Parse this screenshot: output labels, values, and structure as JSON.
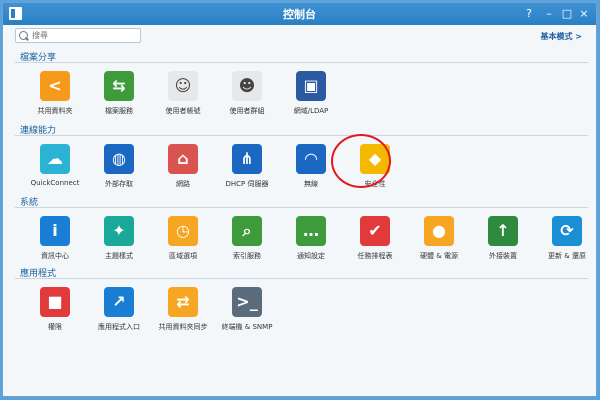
{
  "window": {
    "title": "控制台"
  },
  "controls": {
    "help": "?",
    "minimize": "–",
    "maximize": "□",
    "close": "×"
  },
  "search": {
    "placeholder": "搜尋"
  },
  "mode_link": "基本模式 >",
  "sections": [
    {
      "title": "檔案分享",
      "items": [
        {
          "label": "共用資料夾",
          "icon": "share-icon",
          "color": "#f59a1a"
        },
        {
          "label": "檔案服務",
          "icon": "file-transfer-icon",
          "color": "#3e9b3b"
        },
        {
          "label": "使用者帳號",
          "icon": "user-icon",
          "color": "#e8e8e8"
        },
        {
          "label": "使用者群組",
          "icon": "user-group-icon",
          "color": "#e8e8e8"
        },
        {
          "label": "網域/LDAP",
          "icon": "directory-icon",
          "color": "#2c5aa0"
        }
      ]
    },
    {
      "title": "連線能力",
      "items": [
        {
          "label": "QuickConnect",
          "icon": "quickconnect-icon",
          "color": "#2bb3d4"
        },
        {
          "label": "外部存取",
          "icon": "globe-icon",
          "color": "#1a68c2"
        },
        {
          "label": "網路",
          "icon": "network-house-icon",
          "color": "#d9534f"
        },
        {
          "label": "DHCP 伺服器",
          "icon": "dhcp-icon",
          "color": "#1a68c2"
        },
        {
          "label": "無線",
          "icon": "wifi-icon",
          "color": "#1a68c2"
        },
        {
          "label": "安全性",
          "icon": "shield-icon",
          "color": "#f5b800"
        }
      ]
    },
    {
      "title": "系統",
      "items": [
        {
          "label": "資訊中心",
          "icon": "info-icon",
          "color": "#1a7fd4"
        },
        {
          "label": "主題樣式",
          "icon": "palette-icon",
          "color": "#1aa89a"
        },
        {
          "label": "區域選項",
          "icon": "clock-map-icon",
          "color": "#f5a623"
        },
        {
          "label": "索引服務",
          "icon": "magnifier-icon",
          "color": "#3e9b3b"
        },
        {
          "label": "通知設定",
          "icon": "chat-bubble-icon",
          "color": "#3e9b3b"
        },
        {
          "label": "任務排程表",
          "icon": "calendar-check-icon",
          "color": "#e03a3a"
        },
        {
          "label": "硬體 & 電源",
          "icon": "lightbulb-icon",
          "color": "#f5a623"
        },
        {
          "label": "外接裝置",
          "icon": "upload-icon",
          "color": "#2e8b3e"
        },
        {
          "label": "更新 & 還原",
          "icon": "refresh-icon",
          "color": "#1a8fd4"
        }
      ]
    },
    {
      "title": "應用程式",
      "items": [
        {
          "label": "權限",
          "icon": "permission-icon",
          "color": "#e03a3a"
        },
        {
          "label": "應用程式入口",
          "icon": "portal-icon",
          "color": "#1a7fd4"
        },
        {
          "label": "共用資料夾同步",
          "icon": "folder-sync-icon",
          "color": "#f5a623"
        },
        {
          "label": "終端機 & SNMP",
          "icon": "terminal-icon",
          "color": "#5a6b7c"
        }
      ]
    }
  ]
}
